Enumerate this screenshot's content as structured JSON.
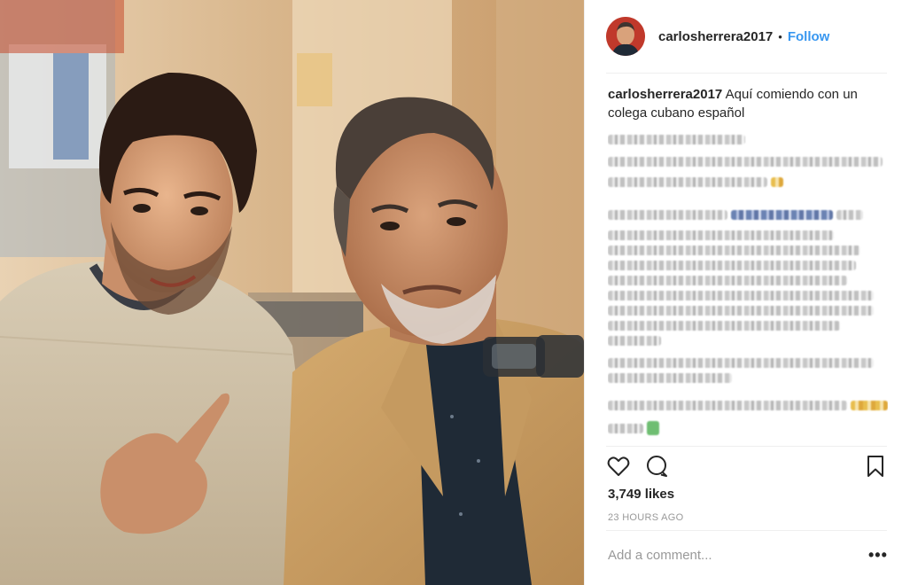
{
  "post": {
    "username": "carlosherrera2017",
    "separator": "•",
    "follow_label": "Follow",
    "caption_user": "carlosherrera2017",
    "caption_text": " Aquí comiendo con un colega cubano español",
    "likes": "3,749 likes",
    "timestamp": "23 HOURS AGO",
    "comment_placeholder": "Add a comment...",
    "more_label": "•••"
  },
  "icons": {
    "like": "heart-icon",
    "comment": "comment-bubble-icon",
    "save": "bookmark-icon",
    "options": "more-options-icon"
  },
  "colors": {
    "follow": "#3897f0",
    "text": "#262626",
    "muted": "#999999",
    "divider": "#efefef"
  }
}
